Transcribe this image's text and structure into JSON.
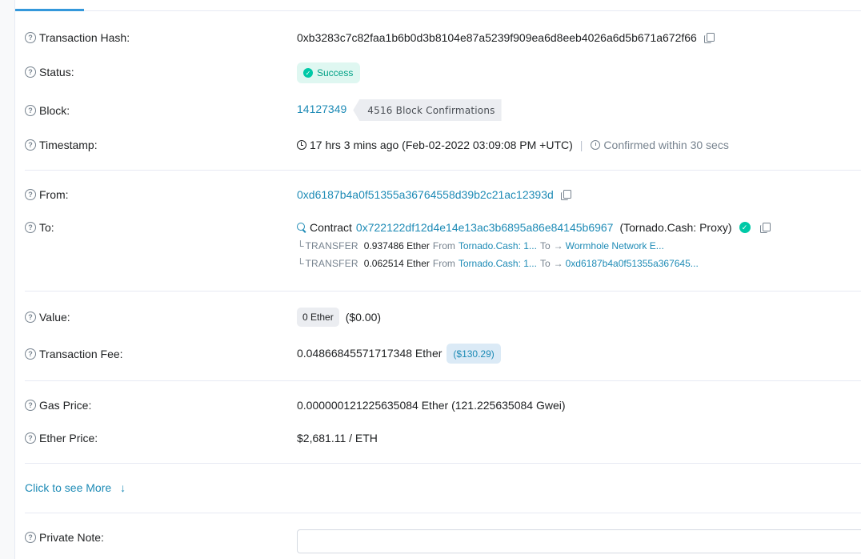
{
  "labels": {
    "tx_hash": "Transaction Hash:",
    "status": "Status:",
    "block": "Block:",
    "timestamp": "Timestamp:",
    "from": "From:",
    "to": "To:",
    "value": "Value:",
    "fee": "Transaction Fee:",
    "gas_price": "Gas Price:",
    "ether_price": "Ether Price:",
    "private_note": "Private Note:"
  },
  "tx_hash": "0xb3283c7c82faa1b6b0d3b8104e87a5239f909ea6d8eeb4026a6d5b671a672f66",
  "status": "Success",
  "block": {
    "number": "14127349",
    "confirmations": "4516 Block Confirmations"
  },
  "timestamp": {
    "age": "17 hrs 3 mins ago (Feb-02-2022 03:09:08 PM +UTC)",
    "separator": "|",
    "confirmed": "Confirmed within 30 secs"
  },
  "from_address": "0xd6187b4a0f51355a36764558d39b2c21ac12393d",
  "to": {
    "prefix": "Contract",
    "address": "0x722122df12d4e14e13ac3b6895a86e84145b6967",
    "name": "(Tornado.Cash: Proxy)",
    "transfers": [
      {
        "tree": "└",
        "keyword": "TRANSFER",
        "amount": "0.937486 Ether",
        "from_label": "From",
        "from": "Tornado.Cash: 1...",
        "to_label": "To",
        "arrow": "→",
        "to": "Wormhole Network E..."
      },
      {
        "tree": "└",
        "keyword": "TRANSFER",
        "amount": "0.062514 Ether",
        "from_label": "From",
        "from": "Tornado.Cash: 1...",
        "to_label": "To",
        "arrow": "→",
        "to": "0xd6187b4a0f51355a367645..."
      }
    ]
  },
  "value": {
    "amount": "0 Ether",
    "usd": "($0.00)"
  },
  "fee": {
    "amount": "0.04866845571717348 Ether",
    "usd": "($130.29)"
  },
  "gas_price": "0.000000121225635084 Ether (121.225635084 Gwei)",
  "ether_price": "$2,681.11 / ETH",
  "more_link": "Click to see More",
  "private_note_value": "",
  "colors": {
    "link": "#1e8bb6",
    "success": "#00a186",
    "success_bg": "#dff7f1",
    "divider": "#e7eaf3"
  },
  "icons": {
    "help": "question-circle-icon",
    "copy": "copy-icon",
    "clock": "clock-icon",
    "timer": "timer-icon",
    "contract": "search-icon",
    "verified": "verified-check-icon",
    "more": "arrow-down-icon"
  }
}
